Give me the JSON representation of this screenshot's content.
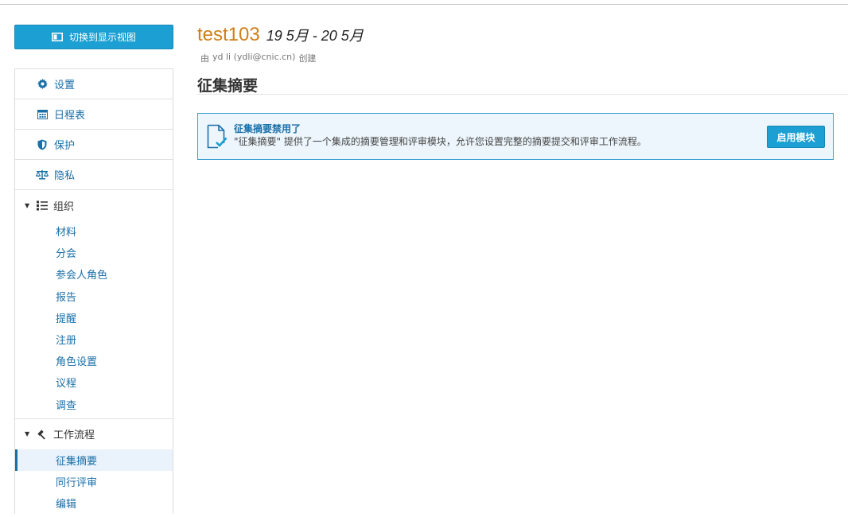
{
  "toolbar": {
    "switch_view_label": "切换到显示视图"
  },
  "sidebar": {
    "items": [
      {
        "label": "设置",
        "icon": "gear-icon"
      },
      {
        "label": "日程表",
        "icon": "calendar-icon"
      },
      {
        "label": "保护",
        "icon": "shield-icon"
      },
      {
        "label": "隐私",
        "icon": "scale-icon"
      }
    ],
    "groups": [
      {
        "label": "组织",
        "icon": "list-icon",
        "items": [
          "材料",
          "分会",
          "参会人角色",
          "报告",
          "提醒",
          "注册",
          "角色设置",
          "议程",
          "调查"
        ]
      },
      {
        "label": "工作流程",
        "icon": "gavel-icon",
        "items": [
          "征集摘要",
          "同行评审",
          "编辑"
        ],
        "active": "征集摘要"
      }
    ]
  },
  "header": {
    "conference_name": "test103",
    "dates": "19 5月 - 20 5月",
    "created_prefix": "由",
    "creator": "yd li (ydli@cnic.cn)",
    "created_suffix": "创建"
  },
  "main": {
    "page_title": "征集摘要",
    "notice": {
      "title": "征集摘要禁用了",
      "description": "\"征集摘要\" 提供了一个集成的摘要管理和评审模块，允许您设置完整的摘要提交和评审工作流程。",
      "button_label": "启用模块",
      "icon": "document-check-icon"
    }
  },
  "colors": {
    "accent": "#1c9fd2",
    "link": "#1a6fa8",
    "title_orange": "#d07e17",
    "notice_bg": "#edf6fc",
    "notice_border": "#3a9fd1"
  }
}
